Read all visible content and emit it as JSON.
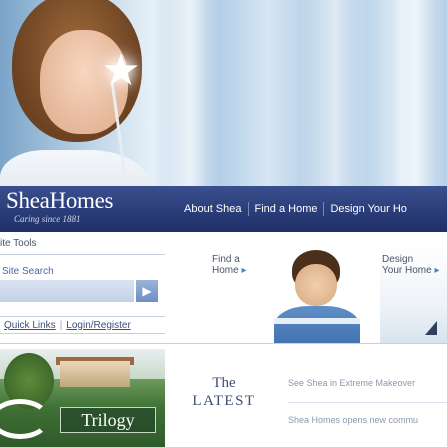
{
  "brand": {
    "logo": "SheaHomes",
    "tagline": "Caring since 1881"
  },
  "nav": {
    "items": [
      "About Shea",
      "Find a Home",
      "Design Your Ho"
    ]
  },
  "tools": {
    "label": "ite Tools"
  },
  "search": {
    "label": "Site Search",
    "placeholder": "",
    "button_icon": "arrow-right-icon"
  },
  "quick": {
    "quick_links": "Quick Links",
    "login": "Login/Register"
  },
  "find_home": {
    "line1": "Find a",
    "line2": "Home",
    "arrow": "▸"
  },
  "design_home": {
    "line1": "Design",
    "line2": "Your Home",
    "arrow": "▸"
  },
  "trilogy": {
    "label": "Trilogy"
  },
  "latest": {
    "line1": "The",
    "line2": "LATEST"
  },
  "news": [
    "See Shea in Extreme Makeover",
    "Shea Homes opens new commu"
  ],
  "colors": {
    "nav_bg": "#26366f",
    "accent": "#4f7ec1",
    "link": "#3d4f7c"
  }
}
